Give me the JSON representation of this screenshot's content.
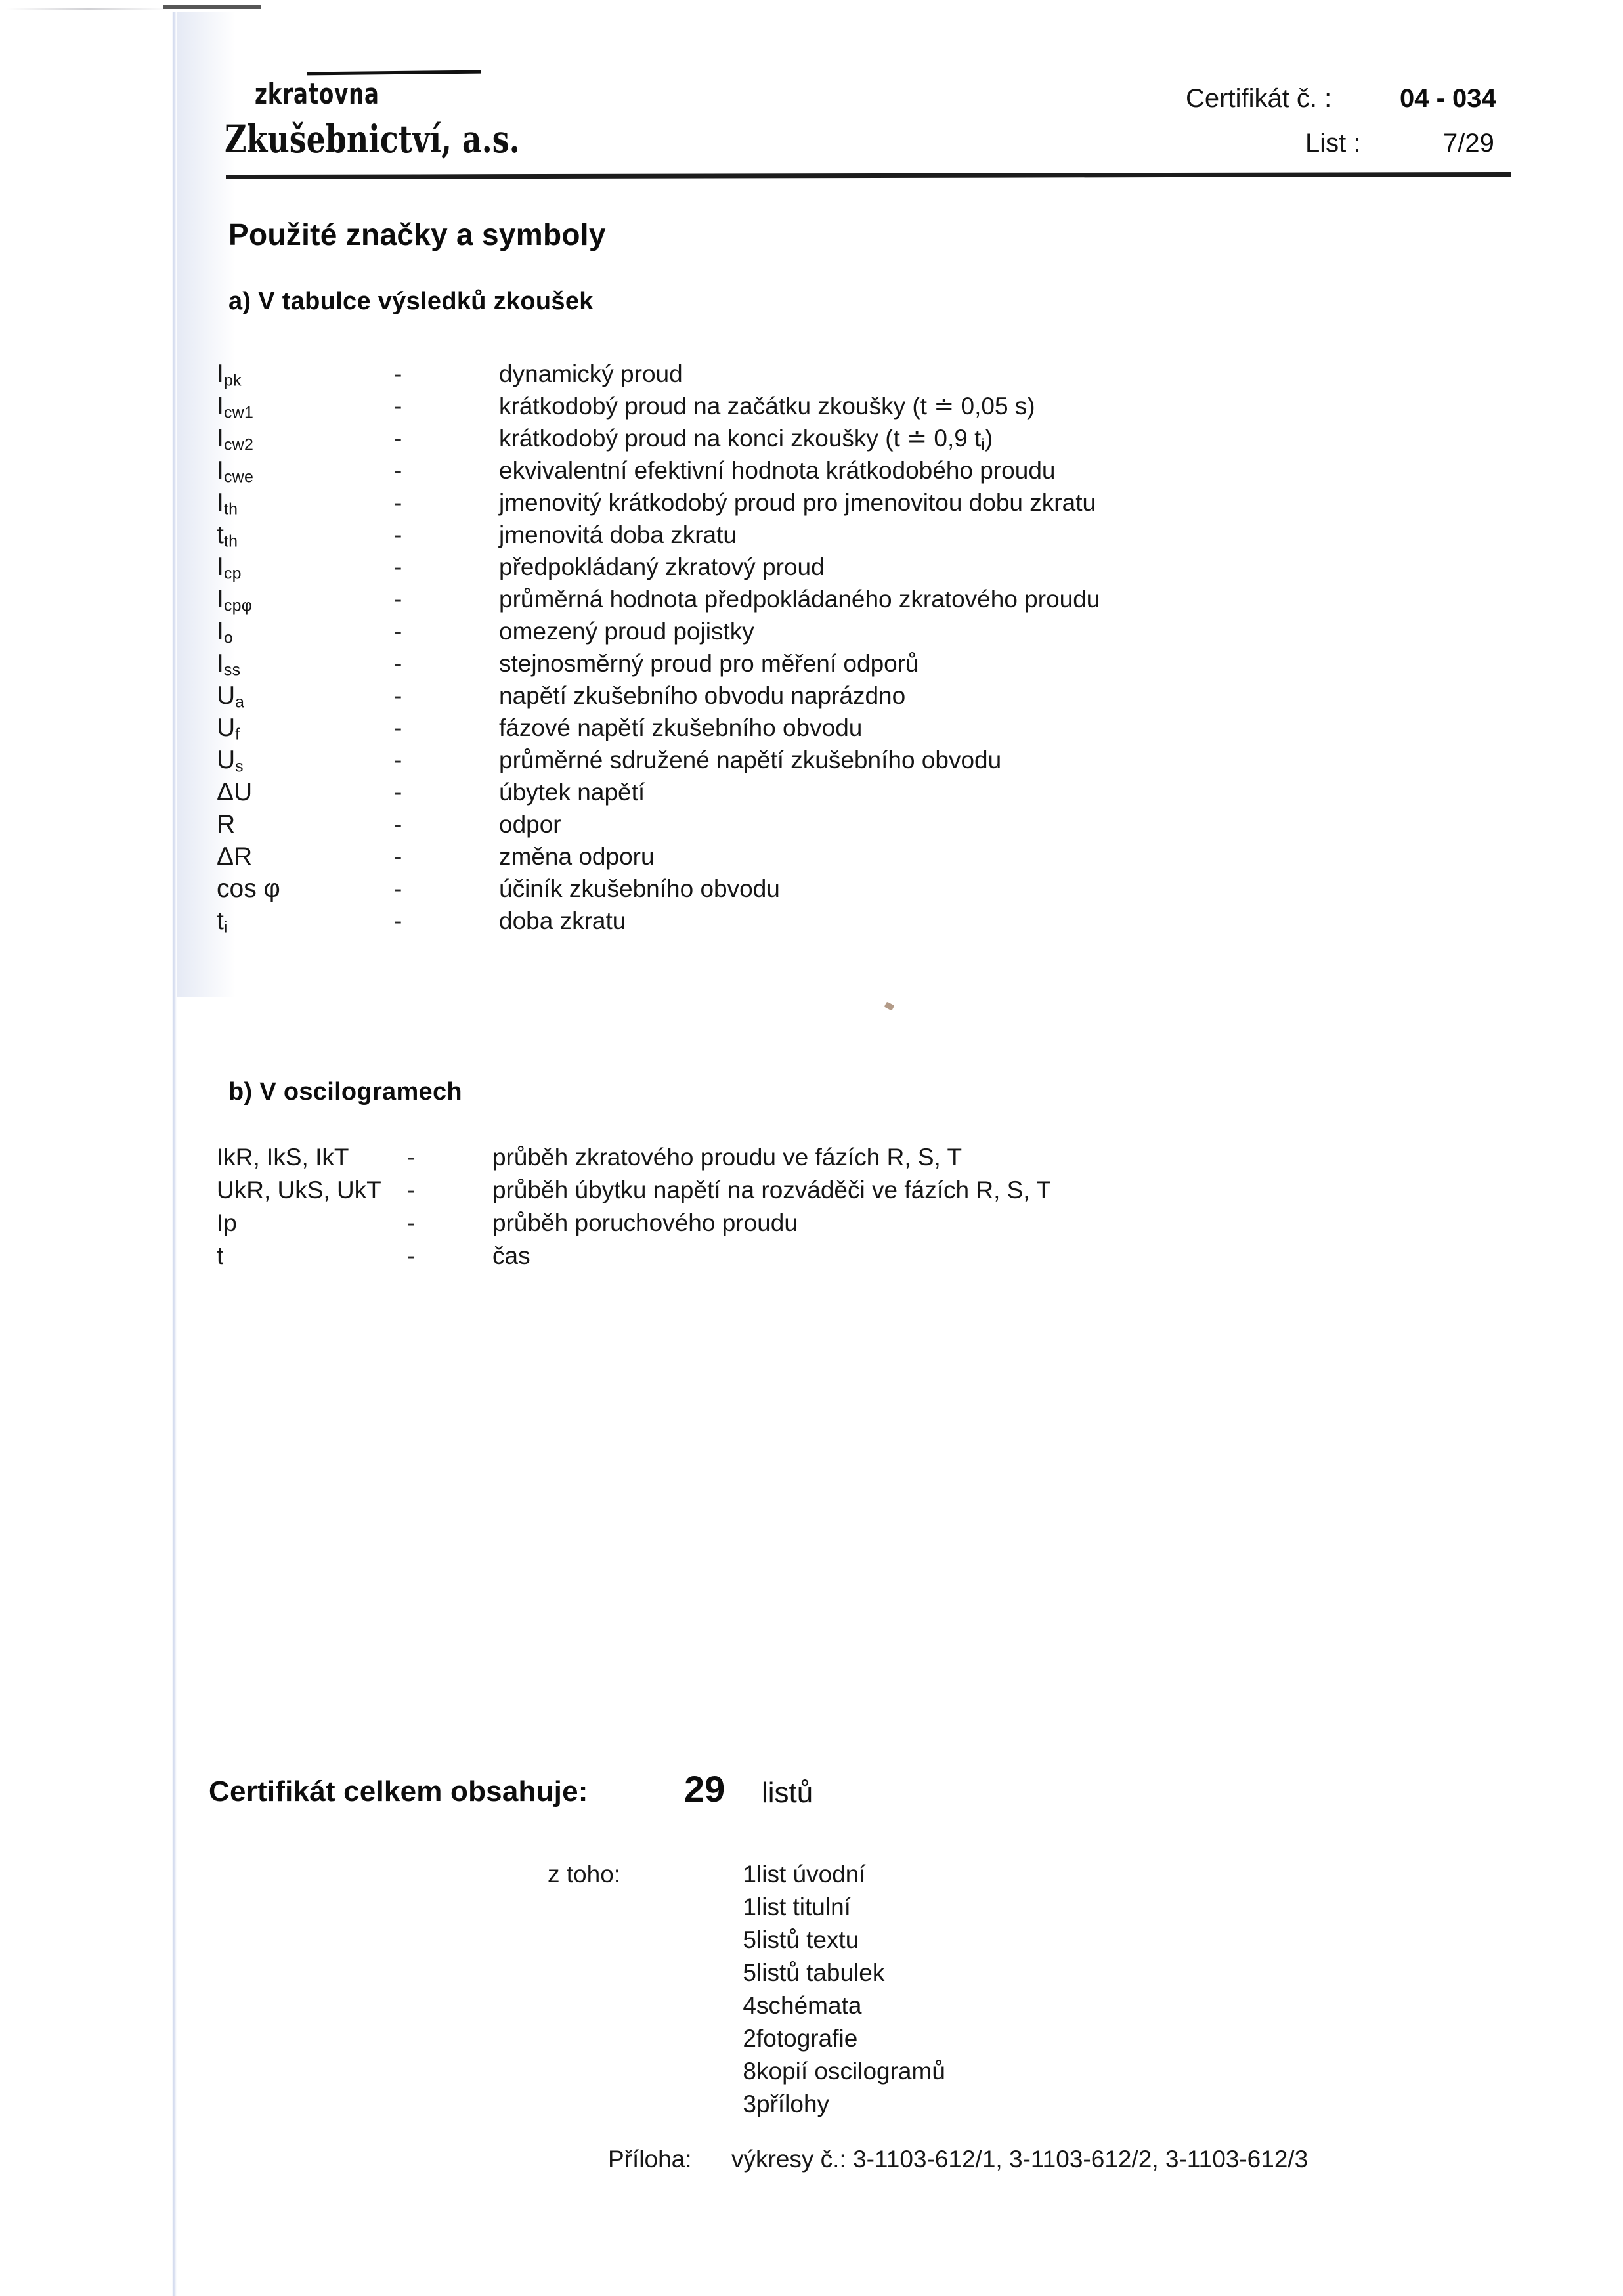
{
  "header": {
    "logo_script": "zkratovna",
    "logo_main": "Zkušebnictví, a.s.",
    "certificate_label": "Certifikát č. :",
    "certificate_value": "04 - 034",
    "sheet_label": "List :",
    "sheet_value": "7/29"
  },
  "page_title": "Použité značky a symboly",
  "section_a": {
    "heading": "a) V tabulce výsledků zkoušek",
    "dash": "-",
    "rows": [
      {
        "symbol_base": "I",
        "symbol_sub": "pk",
        "desc": "dynamický proud"
      },
      {
        "symbol_base": "I",
        "symbol_sub": "cw1",
        "desc": "krátkodobý proud na začátku zkoušky (t ≐ 0,05 s)"
      },
      {
        "symbol_base": "I",
        "symbol_sub": "cw2",
        "desc": "krátkodobý proud na konci zkoušky (t ≐ 0,9 t",
        "desc_sub": "i",
        "desc_tail": ")"
      },
      {
        "symbol_base": "I",
        "symbol_sub": "cwe",
        "desc": "ekvivalentní efektivní hodnota krátkodobého proudu"
      },
      {
        "symbol_base": "I",
        "symbol_sub": "th",
        "desc": "jmenovitý krátkodobý proud pro jmenovitou dobu zkratu"
      },
      {
        "symbol_base": "t",
        "symbol_sub": "th",
        "desc": "jmenovitá doba zkratu"
      },
      {
        "symbol_base": "I",
        "symbol_sub": "cp",
        "desc": "předpokládaný zkratový proud"
      },
      {
        "symbol_base": "I",
        "symbol_sub": "cpφ",
        "desc": "průměrná hodnota předpokládaného zkratového proudu"
      },
      {
        "symbol_base": "I",
        "symbol_sub": "o",
        "desc": "omezený proud pojistky"
      },
      {
        "symbol_base": "I",
        "symbol_sub": "ss",
        "desc": "stejnosměrný proud pro měření odporů"
      },
      {
        "symbol_base": "U",
        "symbol_sub": "a",
        "desc": "napětí zkušebního obvodu naprázdno"
      },
      {
        "symbol_base": "U",
        "symbol_sub": "f",
        "desc": "fázové napětí zkušebního obvodu"
      },
      {
        "symbol_base": "U",
        "symbol_sub": "s",
        "desc": "průměrné sdružené napětí zkušebního obvodu"
      },
      {
        "symbol_base": "ΔU",
        "symbol_sub": "",
        "desc": "úbytek napětí"
      },
      {
        "symbol_base": "R",
        "symbol_sub": "",
        "desc": "odpor"
      },
      {
        "symbol_base": "ΔR",
        "symbol_sub": "",
        "desc": "změna odporu"
      },
      {
        "symbol_base": "cos φ",
        "symbol_sub": "",
        "desc": "účiník zkušebního obvodu"
      },
      {
        "symbol_base": "t",
        "symbol_sub": "i",
        "desc": "doba zkratu"
      }
    ]
  },
  "section_b": {
    "heading": "b) V oscilogramech",
    "dash": "-",
    "rows": [
      {
        "symbol_base": "IkR, IkS, IkT",
        "symbol_sub": "",
        "desc": "průběh zkratového proudu ve fázích R, S, T"
      },
      {
        "symbol_base": "UkR, UkS, UkT",
        "symbol_sub": "",
        "desc": "průběh úbytku napětí na rozváděči ve fázích R, S, T"
      },
      {
        "symbol_base": "Ip",
        "symbol_sub": "",
        "desc": "průběh poruchového proudu"
      },
      {
        "symbol_base": "t",
        "symbol_sub": "",
        "desc": "čas"
      }
    ]
  },
  "totals": {
    "label": "Certifikát celkem obsahuje:",
    "count": "29",
    "unit": "listů",
    "breakdown_lead": "z toho:",
    "breakdown": [
      {
        "count": "1",
        "text": "list úvodní"
      },
      {
        "count": "1",
        "text": "list titulní"
      },
      {
        "count": "5",
        "text": "listů textu"
      },
      {
        "count": "5",
        "text": "listů tabulek"
      },
      {
        "count": "4",
        "text": "schémata"
      },
      {
        "count": "2",
        "text": "fotografie"
      },
      {
        "count": "8",
        "text": "kopií oscilogramů"
      },
      {
        "count": "3",
        "text": "přílohy"
      }
    ]
  },
  "annex": {
    "label": "Příloha:",
    "text": "výkresy č.: 3-1103-612/1, 3-1103-612/2, 3-1103-612/3"
  }
}
